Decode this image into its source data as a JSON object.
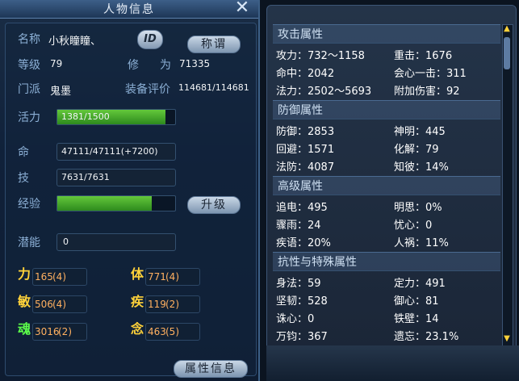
{
  "window": {
    "title": "人物信息",
    "close": "✕"
  },
  "profile": {
    "name_label": "名称",
    "name_value": "小秋瞳瞳、",
    "id_badge": "ID",
    "title_button": "称谓",
    "level_label": "等级",
    "level_value": "79",
    "cultivation_label_a": "修",
    "cultivation_label_b": "为",
    "cultivation_value": "71335",
    "sect_label": "门派",
    "sect_value": "鬼墨",
    "gear_label": "装备评价",
    "gear_value": "114681/114681"
  },
  "vitals": {
    "stamina_label": "活力",
    "stamina_value": "1381/1500",
    "stamina_fraction": 0.92,
    "hp_label": "命",
    "hp_value": "47111/47111(+7200)",
    "skill_label": "技",
    "skill_value": "7631/7631",
    "exp_label": "经验",
    "exp_fraction": 0.8,
    "upgrade_button": "升级",
    "potential_label": "潜能",
    "potential_value": "0"
  },
  "attributes": [
    {
      "name": "力",
      "value": "165",
      "plus": "(4)",
      "color": "#ffd23a"
    },
    {
      "name": "体",
      "value": "771",
      "plus": "(4)",
      "color": "#ffd23a"
    },
    {
      "name": "敏",
      "value": "506",
      "plus": "(4)",
      "color": "#ffd23a"
    },
    {
      "name": "疾",
      "value": "119",
      "plus": "(2)",
      "color": "#ffd23a"
    },
    {
      "name": "魂",
      "value": "3016",
      "plus": "(2)",
      "color": "#5cff4a"
    },
    {
      "name": "念",
      "value": "463",
      "plus": "(5)",
      "color": "#ffd23a"
    }
  ],
  "attr_info_button": "属性信息",
  "attack": {
    "header": "攻击属性",
    "rows": [
      [
        "攻力：732～1158",
        "重击：1676"
      ],
      [
        "命中：2042",
        "会心一击：311"
      ],
      [
        "法力：2502～5693",
        "附加伤害：92"
      ]
    ]
  },
  "defense": {
    "header": "防御属性",
    "rows": [
      [
        "防御：2853",
        "神明：445"
      ],
      [
        "回避：1571",
        "化解：79"
      ],
      [
        "法防：4087",
        "知彼：14%"
      ]
    ]
  },
  "advanced": {
    "header": "高级属性",
    "rows": [
      [
        "追电：495",
        "明思：0%"
      ],
      [
        "骤雨：24",
        "忧心：0"
      ],
      [
        "疾语：20%",
        "人祸：11%"
      ]
    ]
  },
  "special": {
    "header": "抗性与特殊属性",
    "rows": [
      [
        "身法：59",
        "定力：491"
      ],
      [
        "坚韧：528",
        "御心：81"
      ],
      [
        "诛心：0",
        "铁壁：14"
      ],
      [
        "万钧：367",
        "遗忘：23.1%"
      ]
    ]
  },
  "scroll": {
    "up": "▲",
    "down": "▼"
  }
}
